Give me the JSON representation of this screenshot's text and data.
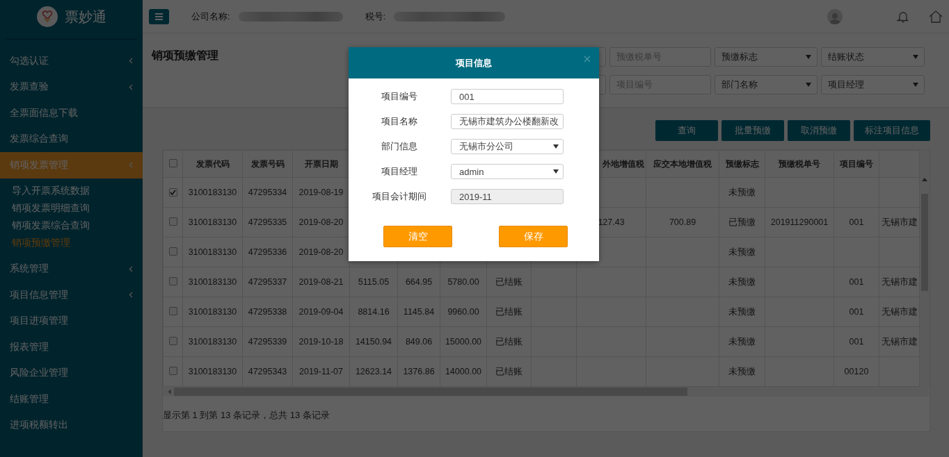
{
  "sidebar": {
    "brand": "票妙通",
    "items": [
      {
        "label": "勾选认证",
        "expandable": true,
        "selected": false
      },
      {
        "label": "发票查验",
        "expandable": true,
        "selected": false
      },
      {
        "label": "全票面信息下载",
        "expandable": false,
        "selected": false
      },
      {
        "label": "发票综合查询",
        "expandable": false,
        "selected": false
      },
      {
        "label": "销项发票管理",
        "expandable": true,
        "selected": true,
        "children": [
          {
            "label": "导入开票系统数据",
            "selected": false
          },
          {
            "label": "销项发票明细查询",
            "selected": false
          },
          {
            "label": "销项发票综合查询",
            "selected": false
          },
          {
            "label": "销项预缴管理",
            "selected": true
          }
        ]
      },
      {
        "label": "系统管理",
        "expandable": true,
        "selected": false
      },
      {
        "label": "项目信息管理",
        "expandable": true,
        "selected": false
      },
      {
        "label": "项目进项管理",
        "expandable": false,
        "selected": false
      },
      {
        "label": "报表管理",
        "expandable": false,
        "selected": false
      },
      {
        "label": "风险企业管理",
        "expandable": false,
        "selected": false
      },
      {
        "label": "结账管理",
        "expandable": false,
        "selected": false
      },
      {
        "label": "进项税额转出",
        "expandable": false,
        "selected": false
      }
    ]
  },
  "topbar": {
    "company_label": "公司名称:",
    "tax_label": "税号:"
  },
  "page_title": "销项预缴管理",
  "filters": [
    [
      {
        "kind": "input"
      },
      {
        "kind": "input",
        "placeholder": "预缴税单号"
      },
      {
        "kind": "select",
        "placeholder": "预缴标志"
      },
      {
        "kind": "select",
        "placeholder": "结账状态"
      }
    ],
    [
      {
        "kind": "input"
      },
      {
        "kind": "input",
        "placeholder": "项目编号"
      },
      {
        "kind": "select",
        "placeholder": "部门名称"
      },
      {
        "kind": "select",
        "placeholder": "项目经理"
      }
    ]
  ],
  "actions": [
    "查询",
    "批量预缴",
    "取消预缴",
    "标注项目信息"
  ],
  "table": {
    "select_all": false,
    "columns": [
      {
        "label": "发票代码"
      },
      {
        "label": "发票号码"
      },
      {
        "label": "开票日期"
      },
      {},
      {},
      {},
      {},
      {},
      {
        "label": "外地增值税"
      },
      {
        "label": "应交本地增值税"
      },
      {
        "label": "预缴标志"
      },
      {
        "label": "预缴税单号"
      },
      {
        "label": "项目编号"
      },
      {}
    ],
    "rows": [
      {
        "selected": true,
        "cells": [
          "3100183130",
          "47295334",
          "2019-08-19",
          null,
          null,
          null,
          null,
          null,
          null,
          null,
          "未预缴",
          null,
          null,
          null
        ]
      },
      {
        "selected": false,
        "cells": [
          "3100183130",
          "47295335",
          "2019-08-20",
          null,
          null,
          null,
          null,
          null,
          "127.43",
          "700.89",
          "已预缴",
          "201911290001",
          "001",
          "无锡市建"
        ]
      },
      {
        "selected": false,
        "cells": [
          "3100183130",
          "47295336",
          "2019-08-20",
          null,
          null,
          null,
          null,
          null,
          null,
          null,
          "未预缴",
          null,
          null,
          null
        ]
      },
      {
        "selected": false,
        "cells": [
          "3100183130",
          "47295337",
          "2019-08-21",
          "5115.05",
          "664.95",
          "5780.00",
          "已结账",
          null,
          null,
          null,
          "未预缴",
          null,
          "001",
          "无锡市建"
        ]
      },
      {
        "selected": false,
        "cells": [
          "3100183130",
          "47295338",
          "2019-09-04",
          "8814.16",
          "1145.84",
          "9960.00",
          "已结账",
          null,
          null,
          null,
          "未预缴",
          null,
          "001",
          "无锡市建"
        ]
      },
      {
        "selected": false,
        "cells": [
          "3100183130",
          "47295339",
          "2019-10-18",
          "14150.94",
          "849.06",
          "15000.00",
          "已结账",
          null,
          null,
          null,
          "未预缴",
          null,
          "001",
          "无锡市建"
        ]
      },
      {
        "selected": false,
        "cells": [
          "3100183130",
          "47295343",
          "2019-11-07",
          "12623.14",
          "1376.86",
          "14000.00",
          "已结账",
          null,
          null,
          null,
          "未预缴",
          null,
          "00120",
          null
        ]
      }
    ],
    "footer": "显示第 1 到第 13 条记录，总共 13 条记录"
  },
  "dialog": {
    "title": "项目信息",
    "fields": [
      {
        "label": "项目编号",
        "kind": "input",
        "value": "001",
        "disabled": false
      },
      {
        "label": "项目名称",
        "kind": "input",
        "value": "无锡市建筑办公楼翻新改",
        "disabled": false
      },
      {
        "label": "部门信息",
        "kind": "select",
        "value": "无锡市分公司",
        "disabled": false
      },
      {
        "label": "项目经理",
        "kind": "select",
        "value": "admin",
        "disabled": false
      },
      {
        "label": "项目会计期间",
        "kind": "input",
        "value": "2019-11",
        "disabled": true
      }
    ],
    "buttons": [
      "清空",
      "保存"
    ]
  }
}
